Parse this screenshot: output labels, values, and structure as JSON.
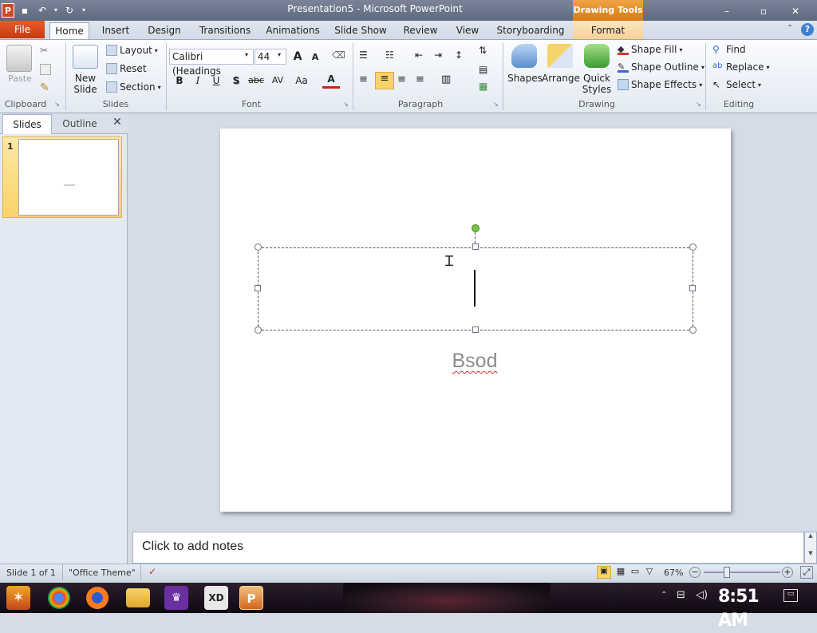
{
  "window": {
    "title": "Presentation5 - Microsoft PowerPoint",
    "contextual_tab_group": "Drawing Tools",
    "controls": {
      "minimize": "–",
      "maximize": "▫",
      "close": "✕"
    }
  },
  "tabs": [
    {
      "label": "File"
    },
    {
      "label": "Home"
    },
    {
      "label": "Insert"
    },
    {
      "label": "Design"
    },
    {
      "label": "Transitions"
    },
    {
      "label": "Animations"
    },
    {
      "label": "Slide Show"
    },
    {
      "label": "Review"
    },
    {
      "label": "View"
    },
    {
      "label": "Storyboarding"
    },
    {
      "label": "Format"
    }
  ],
  "ribbon": {
    "clipboard": {
      "label": "Clipboard",
      "paste": "Paste"
    },
    "slides": {
      "label": "Slides",
      "new_slide_line1": "New",
      "new_slide_line2": "Slide",
      "layout": "Layout",
      "reset": "Reset",
      "section": "Section"
    },
    "font": {
      "label": "Font",
      "font_name": "Calibri (Headings",
      "font_size": "44",
      "bold": "B",
      "italic": "I",
      "underline": "U",
      "shadow": "S",
      "strike": "abc",
      "spacing": "AV",
      "case": "Aa",
      "color": "A",
      "grow": "A",
      "shrink": "A"
    },
    "paragraph": {
      "label": "Paragraph"
    },
    "drawing": {
      "label": "Drawing",
      "shapes": "Shapes",
      "arrange": "Arrange",
      "quick_styles_line1": "Quick",
      "quick_styles_line2": "Styles",
      "shape_fill": "Shape Fill",
      "shape_outline": "Shape Outline",
      "shape_effects": "Shape Effects"
    },
    "editing": {
      "label": "Editing",
      "find": "Find",
      "replace": "Replace",
      "select": "Select"
    }
  },
  "left_pane": {
    "tab_slides": "Slides",
    "tab_outline": "Outline",
    "slide_number": "1"
  },
  "slide": {
    "subtitle": "Bsod"
  },
  "notes": {
    "placeholder": "Click to add notes"
  },
  "statusbar": {
    "slide_info": "Slide 1 of 1",
    "theme": "\"Office Theme\"",
    "zoom": "67%"
  },
  "taskbar": {
    "clock": "8:51 AM"
  },
  "colors": {
    "file_tab": "#d24726",
    "contextual_accent": "#f0a030",
    "selection_yellow": "#f9d36a"
  }
}
